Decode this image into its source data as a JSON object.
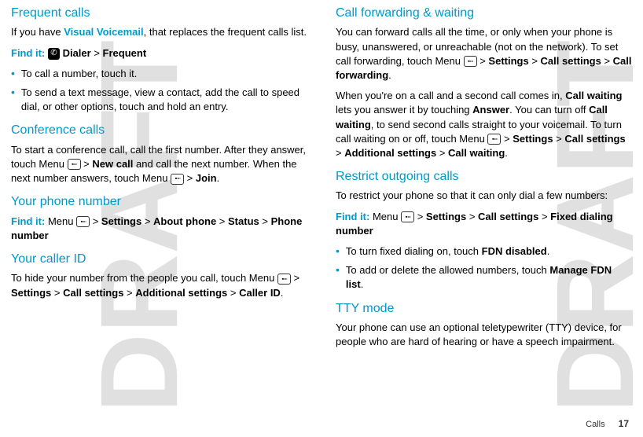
{
  "watermark": "DRAFT",
  "left": {
    "h1": "Frequent calls",
    "p1a": "If you have ",
    "p1link": "Visual Voicemail",
    "p1b": ", that replaces the frequent calls list.",
    "find1_label": "Find it:",
    "find1_dialer": " Dialer",
    "find1_gt": " > ",
    "find1_freq": "Frequent",
    "b1": "To call a number, touch it.",
    "b2": "To send a text message, view a contact, add the call to speed dial, or other options, touch and hold an entry.",
    "h2": "Conference calls",
    "p2a": "To start a conference call, call the first number. After they answer, touch Menu ",
    "p2b": " > ",
    "p2newcall": "New call",
    "p2c": " and call the next number. When the next number answers, touch Menu ",
    "p2d": " > ",
    "p2join": "Join",
    "p2e": ".",
    "h3": "Your phone number",
    "find3_label": "Find it:",
    "find3_a": " Menu ",
    "find3_b": " > ",
    "find3_settings": "Settings",
    "find3_c": " > ",
    "find3_about": "About phone",
    "find3_d": " > ",
    "find3_status": "Status",
    "find3_e": " > ",
    "find3_pn": "Phone number",
    "h4": "Your caller ID",
    "p4a": "To hide your number from the people you call, touch Menu ",
    "p4b": " > ",
    "p4settings": "Settings",
    "p4c": " > ",
    "p4call": "Call settings",
    "p4d": " > ",
    "p4add": "Additional settings",
    "p4e": " > ",
    "p4cid": "Caller ID",
    "p4f": "."
  },
  "right": {
    "h1": "Call forwarding & waiting",
    "p1a": "You can forward calls all the time, or only when your phone is busy, unanswered, or unreachable (not on the network). To set call forwarding, touch Menu ",
    "p1b": " > ",
    "p1settings": "Settings",
    "p1c": " > ",
    "p1call": "Call settings",
    "p1d": " > ",
    "p1cf": "Call forwarding",
    "p1e": ".",
    "p2a": "When you're on a call and a second call comes in, ",
    "p2cw": "Call waiting",
    "p2b": " lets you answer it by touching ",
    "p2ans": "Answer",
    "p2c": ". You can turn off ",
    "p2cw2": "Call waiting",
    "p2d": ", to send second calls straight to your voicemail. To turn call waiting on or off, touch Menu ",
    "p2e": " > ",
    "p2settings": "Settings",
    "p2f": " > ",
    "p2call": "Call settings",
    "p2g": " > ",
    "p2add": "Additional settings",
    "p2h": " > ",
    "p2cw3": "Call waiting",
    "p2i": ".",
    "h2": "Restrict outgoing calls",
    "p3": "To restrict your phone so that it can only dial a few numbers:",
    "find2_label": "Find it:",
    "find2_a": " Menu ",
    "find2_b": " > ",
    "find2_settings": "Settings",
    "find2_c": " > ",
    "find2_call": "Call settings",
    "find2_d": " > ",
    "find2_fdn": "Fixed dialing number",
    "b1a": "To turn fixed dialing on, touch ",
    "b1fdn": "FDN disabled",
    "b1b": ".",
    "b2a": "To add or delete the allowed numbers, touch ",
    "b2mfdn": "Manage FDN list",
    "b2b": ".",
    "h3": "TTY mode",
    "p4": "Your phone can use an optional teletypewriter (TTY) device, for people who are hard of hearing or have a speech impairment."
  },
  "footer": {
    "section": "Calls",
    "page": "17"
  }
}
